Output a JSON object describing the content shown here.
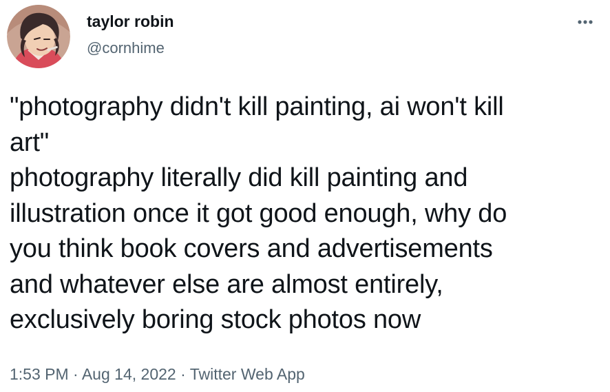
{
  "author": {
    "display_name": "taylor robin",
    "handle": "@cornhime",
    "avatar_icon": "cartoon-portrait-avatar"
  },
  "menu": {
    "more_icon": "more-horizontal-icon"
  },
  "tweet": {
    "lines": [
      "\"photography didn't kill painting, ai won't kill",
      "art\"",
      "photography literally did kill painting and",
      "illustration once it got good enough, why do",
      "you think book covers and advertisements",
      "and whatever else are almost entirely,",
      "exclusively boring stock photos now"
    ]
  },
  "meta": {
    "time": "1:53 PM",
    "separator": "·",
    "date": "Aug 14, 2022",
    "source": "Twitter Web App"
  },
  "colors": {
    "text_primary": "#0f1419",
    "text_secondary": "#536471",
    "background": "#ffffff"
  }
}
